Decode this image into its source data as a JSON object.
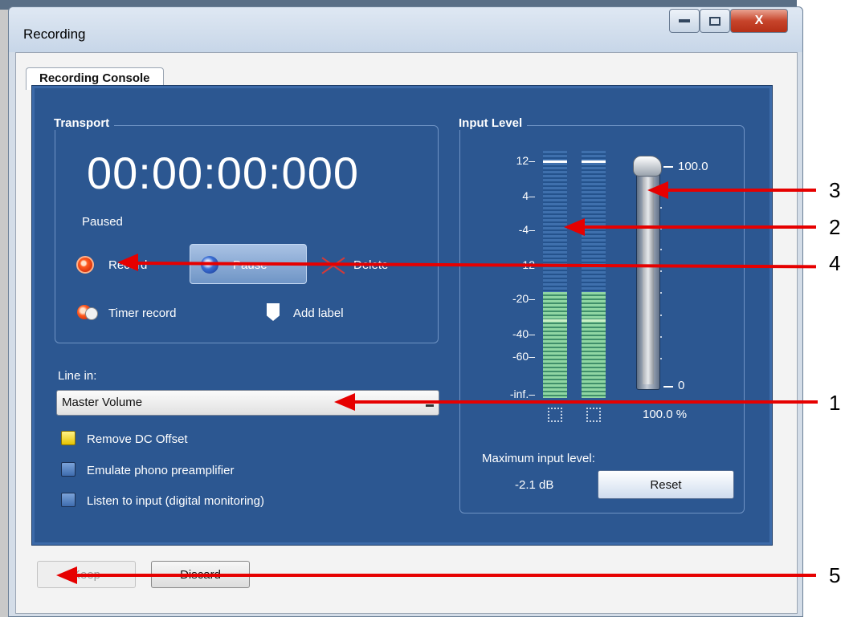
{
  "window": {
    "title": "Recording",
    "close_label": "X"
  },
  "console": {
    "tab_label": "Recording Console"
  },
  "transport": {
    "title": "Transport",
    "time": "00:00:00:000",
    "status": "Paused",
    "record_label": "Record",
    "pause_label": "Pause",
    "delete_label": "Delete",
    "timer_record_label": "Timer record",
    "add_label_label": "Add label"
  },
  "line_in": {
    "label": "Line in:",
    "selected": "Master Volume",
    "options": {
      "remove_dc": "Remove DC Offset",
      "emulate_phono": "Emulate phono preamplifier",
      "listen": "Listen to input (digital monitoring)"
    },
    "remove_dc_checked": true,
    "emulate_phono_checked": false,
    "listen_checked": false
  },
  "input_level": {
    "title": "Input Level",
    "scale": [
      "12–",
      "4–",
      "-4–",
      "-12",
      "-20–",
      "-40–",
      "-60–",
      "-inf.–"
    ],
    "slider_max_label": "100.0",
    "slider_min_label": "0",
    "slider_value_pct": 100,
    "percent_readout": "100.0 %",
    "max_input_label": "Maximum input level:",
    "max_input_value": "-2.1 dB",
    "reset_label": "Reset"
  },
  "dialog": {
    "keep_label": "Keep",
    "discard_label": "Discard"
  },
  "callouts": [
    "1",
    "2",
    "3",
    "4",
    "5"
  ],
  "colors": {
    "accent_red": "#e60000",
    "console_blue": "#2c5791"
  }
}
